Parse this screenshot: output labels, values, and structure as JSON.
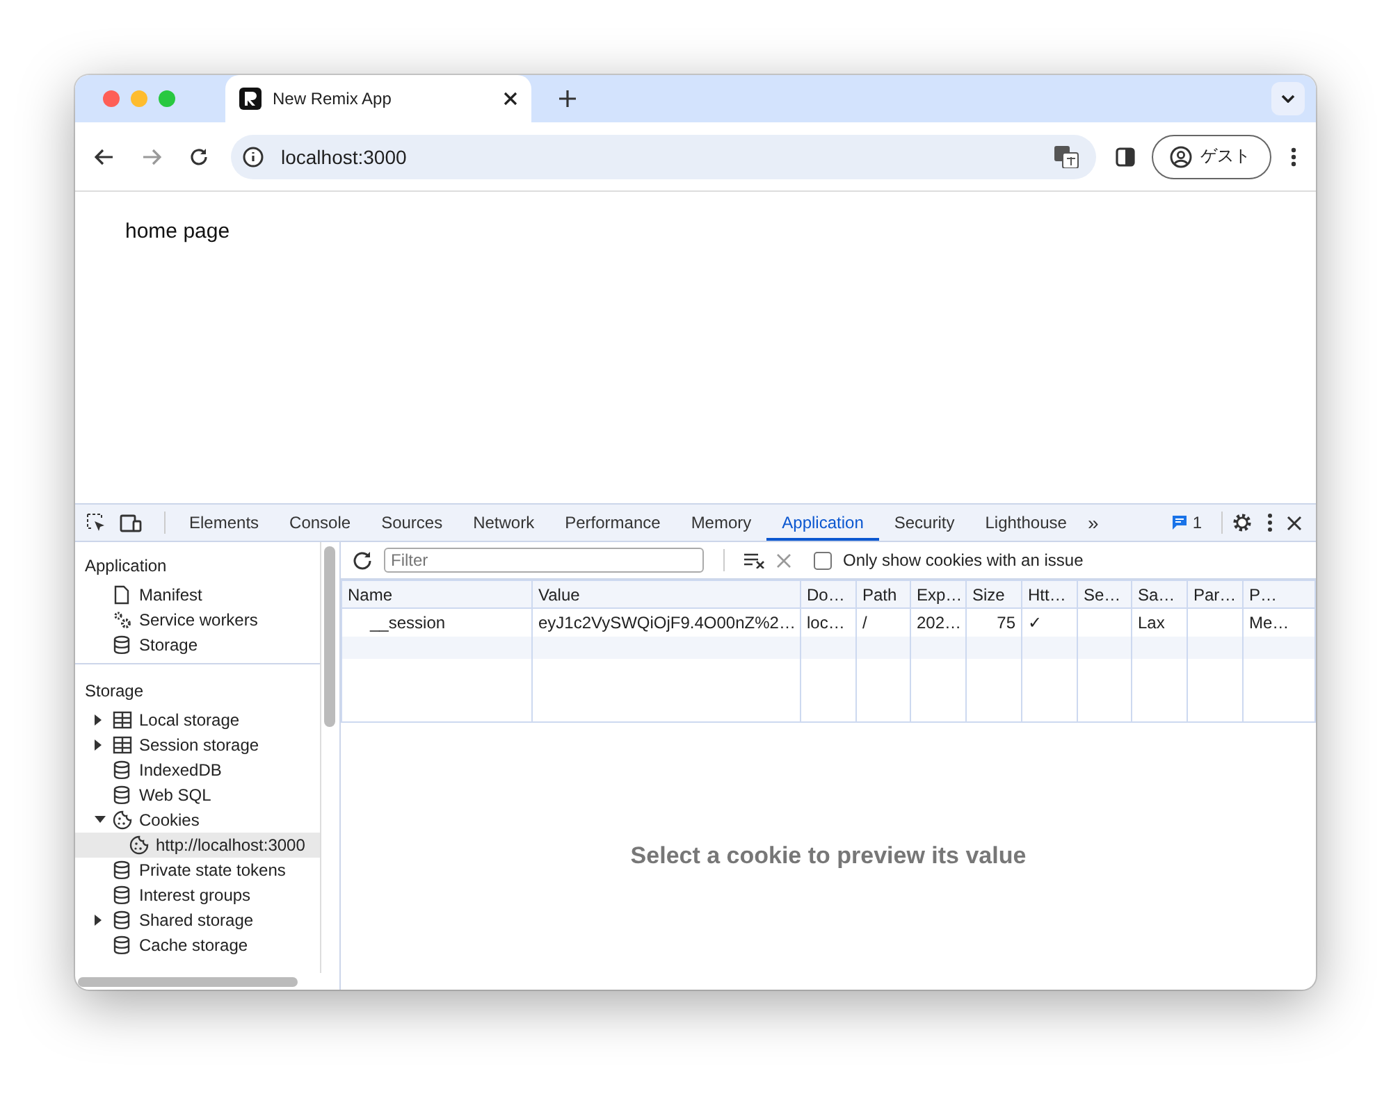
{
  "browser": {
    "tabs": [
      {
        "title": "New Remix App",
        "selected": true
      }
    ],
    "address": "localhost:3000",
    "profile_label": "ゲスト"
  },
  "page": {
    "text": "home page"
  },
  "devtools": {
    "tabs": [
      {
        "label": "Elements",
        "selected": false
      },
      {
        "label": "Console",
        "selected": false
      },
      {
        "label": "Sources",
        "selected": false
      },
      {
        "label": "Network",
        "selected": false
      },
      {
        "label": "Performance",
        "selected": false
      },
      {
        "label": "Memory",
        "selected": false
      },
      {
        "label": "Application",
        "selected": true
      },
      {
        "label": "Security",
        "selected": false
      },
      {
        "label": "Lighthouse",
        "selected": false
      }
    ],
    "overflow": "»",
    "issues_count": "1",
    "sidebar": {
      "sections": [
        {
          "title": "Application",
          "items": [
            {
              "label": "Manifest",
              "kind": "file",
              "selected": false
            },
            {
              "label": "Service workers",
              "kind": "gears",
              "selected": false
            },
            {
              "label": "Storage",
              "kind": "database",
              "selected": false
            }
          ]
        },
        {
          "title": "Storage",
          "items": [
            {
              "label": "Local storage",
              "kind": "table",
              "expanded": false,
              "selected": false
            },
            {
              "label": "Session storage",
              "kind": "table",
              "expanded": false,
              "selected": false
            },
            {
              "label": "IndexedDB",
              "kind": "database",
              "selected": false
            },
            {
              "label": "Web SQL",
              "kind": "database",
              "selected": false
            },
            {
              "label": "Cookies",
              "kind": "cookie",
              "expanded": true,
              "selected": false,
              "children": [
                {
                  "label": "http://localhost:3000",
                  "kind": "cookie",
                  "selected": true
                }
              ]
            },
            {
              "label": "Private state tokens",
              "kind": "database",
              "selected": false
            },
            {
              "label": "Interest groups",
              "kind": "database",
              "selected": false
            },
            {
              "label": "Shared storage",
              "kind": "database",
              "expanded": false,
              "selected": false
            },
            {
              "label": "Cache storage",
              "kind": "database",
              "selected": false
            }
          ]
        }
      ]
    },
    "cookies": {
      "filter": {
        "placeholder": "Filter"
      },
      "issue_filter": {
        "label": "Only show cookies with an issue",
        "checked": false
      },
      "table": {
        "columns": [
          "Name",
          "Value",
          "Do…",
          "Path",
          "Exp…",
          "Size",
          "Htt…",
          "Se…",
          "Sa…",
          "Par…",
          "P…"
        ],
        "rows": [
          {
            "cells": [
              "__session",
              "eyJ1c2VySWQiOjF9.4O00nZ%2…",
              "loc…",
              "/",
              "202…",
              "75",
              "✓",
              "",
              "Lax",
              "",
              "Me…"
            ],
            "selected": false
          }
        ]
      },
      "preview_message": "Select a cookie to preview its value"
    }
  }
}
